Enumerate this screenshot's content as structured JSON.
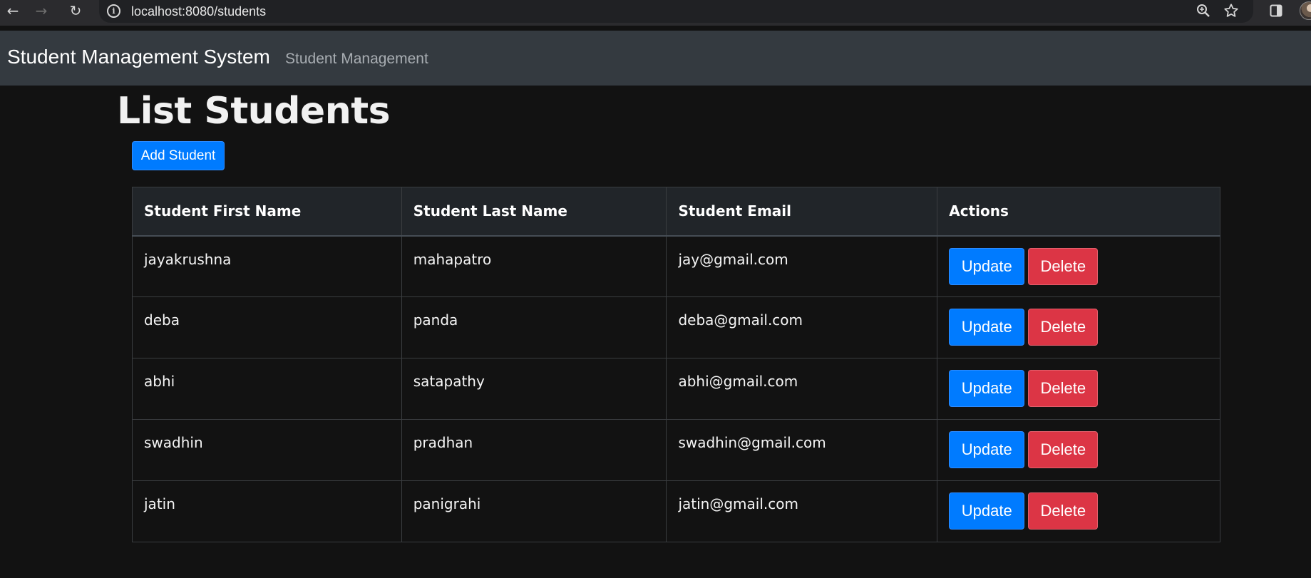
{
  "browser": {
    "url": "localhost:8080/students",
    "icons": [
      "back-arrow-icon",
      "forward-arrow-icon",
      "reload-icon",
      "site-info-icon",
      "zoom-icon",
      "bookmark-star-icon",
      "side-panel-icon",
      "profile-avatar"
    ]
  },
  "navbar": {
    "brand": "Student Management System",
    "link": "Student Management"
  },
  "main": {
    "title": "List Students",
    "add_button": "Add Student"
  },
  "table": {
    "headers": [
      "Student First Name",
      "Student Last Name",
      "Student Email",
      "Actions"
    ],
    "rows": [
      {
        "first": "jayakrushna",
        "last": "mahapatro",
        "email": "jay@gmail.com"
      },
      {
        "first": "deba",
        "last": "panda",
        "email": "deba@gmail.com"
      },
      {
        "first": "abhi",
        "last": "satapathy",
        "email": "abhi@gmail.com"
      },
      {
        "first": "swadhin",
        "last": "pradhan",
        "email": "swadhin@gmail.com"
      },
      {
        "first": "jatin",
        "last": "panigrahi",
        "email": "jatin@gmail.com"
      }
    ],
    "update_label": "Update",
    "delete_label": "Delete"
  },
  "colors": {
    "page_bg": "#121212",
    "navbar_bg": "#343a40",
    "primary": "#007bff",
    "danger": "#dc3545",
    "header_bg": "#212529"
  }
}
